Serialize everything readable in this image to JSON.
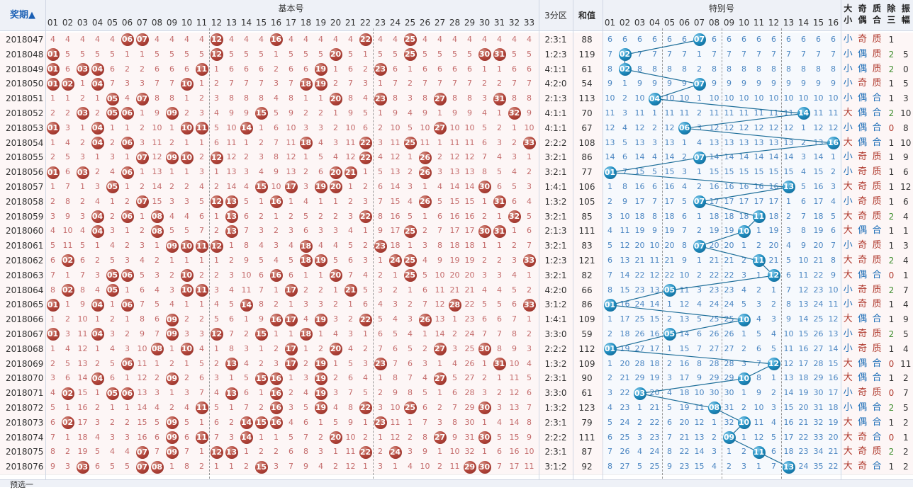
{
  "header": {
    "period_label": "奖期",
    "sort_indicator": "▲",
    "basic_title": "基本号",
    "special_title": "特别号",
    "zone3_label": "3分区",
    "sum_label": "和值",
    "size_label": "大小",
    "parity_label": "奇偶",
    "prime_label": "质合",
    "mod3_label": "除三",
    "amp_label": "振幅"
  },
  "basic_numbers": [
    "01",
    "02",
    "03",
    "04",
    "05",
    "06",
    "07",
    "08",
    "09",
    "10",
    "11",
    "12",
    "13",
    "14",
    "15",
    "16",
    "17",
    "18",
    "19",
    "20",
    "21",
    "22",
    "23",
    "24",
    "25",
    "26",
    "27",
    "28",
    "29",
    "30",
    "31",
    "32",
    "33"
  ],
  "special_numbers": [
    "01",
    "02",
    "03",
    "04",
    "05",
    "06",
    "07",
    "08",
    "09",
    "10",
    "11",
    "12",
    "13",
    "14",
    "15",
    "16"
  ],
  "rows": [
    {
      "period": "2018047",
      "basic": [
        6,
        7,
        12,
        16,
        22,
        25
      ],
      "special": 7,
      "zone": "2:3:1",
      "sum": "88",
      "size": "小",
      "parity": "奇",
      "prime": "质",
      "mod3": "1",
      "amp": ""
    },
    {
      "period": "2018048",
      "basic": [
        1,
        12,
        20,
        25,
        30,
        31
      ],
      "special": 2,
      "zone": "1:2:3",
      "sum": "119",
      "size": "小",
      "parity": "偶",
      "prime": "质",
      "mod3": "2",
      "amp": "5"
    },
    {
      "period": "2018049",
      "basic": [
        1,
        3,
        4,
        11,
        19,
        23
      ],
      "special": 2,
      "zone": "4:1:1",
      "sum": "61",
      "size": "小",
      "parity": "偶",
      "prime": "质",
      "mod3": "2",
      "amp": "0"
    },
    {
      "period": "2018050",
      "basic": [
        1,
        2,
        4,
        10,
        18,
        19
      ],
      "special": 7,
      "zone": "4:2:0",
      "sum": "54",
      "size": "小",
      "parity": "奇",
      "prime": "质",
      "mod3": "1",
      "amp": "5"
    },
    {
      "period": "2018051",
      "basic": [
        5,
        7,
        20,
        23,
        27,
        31
      ],
      "special": 4,
      "zone": "2:1:3",
      "sum": "113",
      "size": "小",
      "parity": "偶",
      "prime": "合",
      "mod3": "1",
      "amp": "3"
    },
    {
      "period": "2018052",
      "basic": [
        3,
        5,
        6,
        9,
        15,
        32
      ],
      "special": 14,
      "zone": "4:1:1",
      "sum": "70",
      "size": "大",
      "parity": "偶",
      "prime": "合",
      "mod3": "2",
      "amp": "10"
    },
    {
      "period": "2018053",
      "basic": [
        1,
        4,
        10,
        11,
        14,
        27
      ],
      "special": 6,
      "zone": "4:1:1",
      "sum": "67",
      "size": "小",
      "parity": "偶",
      "prime": "合",
      "mod3": "0",
      "amp": "8"
    },
    {
      "period": "2018054",
      "basic": [
        4,
        6,
        18,
        22,
        25,
        33
      ],
      "special": 16,
      "zone": "2:2:2",
      "sum": "108",
      "size": "大",
      "parity": "偶",
      "prime": "合",
      "mod3": "1",
      "amp": "10"
    },
    {
      "period": "2018055",
      "basic": [
        7,
        9,
        10,
        12,
        22,
        26
      ],
      "special": 7,
      "zone": "3:2:1",
      "sum": "86",
      "size": "小",
      "parity": "奇",
      "prime": "质",
      "mod3": "1",
      "amp": "9"
    },
    {
      "period": "2018056",
      "basic": [
        1,
        3,
        6,
        20,
        21,
        26
      ],
      "special": 1,
      "zone": "3:2:1",
      "sum": "77",
      "size": "小",
      "parity": "奇",
      "prime": "质",
      "mod3": "1",
      "amp": "6"
    },
    {
      "period": "2018057",
      "basic": [
        5,
        15,
        17,
        19,
        20,
        30
      ],
      "special": 13,
      "zone": "1:4:1",
      "sum": "106",
      "size": "大",
      "parity": "奇",
      "prime": "质",
      "mod3": "1",
      "amp": "12"
    },
    {
      "period": "2018058",
      "basic": [
        7,
        12,
        13,
        16,
        26,
        31
      ],
      "special": 7,
      "zone": "1:3:2",
      "sum": "105",
      "size": "小",
      "parity": "奇",
      "prime": "质",
      "mod3": "1",
      "amp": "6"
    },
    {
      "period": "2018059",
      "basic": [
        4,
        6,
        8,
        13,
        22,
        32
      ],
      "special": 11,
      "zone": "3:2:1",
      "sum": "85",
      "size": "大",
      "parity": "奇",
      "prime": "质",
      "mod3": "2",
      "amp": "4"
    },
    {
      "period": "2018060",
      "basic": [
        4,
        8,
        13,
        25,
        30,
        31
      ],
      "special": 10,
      "zone": "2:1:3",
      "sum": "111",
      "size": "大",
      "parity": "偶",
      "prime": "合",
      "mod3": "1",
      "amp": "1"
    },
    {
      "period": "2018061",
      "basic": [
        9,
        10,
        11,
        12,
        18,
        23
      ],
      "special": 7,
      "zone": "3:2:1",
      "sum": "83",
      "size": "小",
      "parity": "奇",
      "prime": "质",
      "mod3": "1",
      "amp": "3"
    },
    {
      "period": "2018062",
      "basic": [
        2,
        18,
        19,
        24,
        25,
        33
      ],
      "special": 11,
      "zone": "1:2:3",
      "sum": "121",
      "size": "大",
      "parity": "奇",
      "prime": "质",
      "mod3": "2",
      "amp": "4"
    },
    {
      "period": "2018063",
      "basic": [
        5,
        6,
        10,
        16,
        20,
        25
      ],
      "special": 12,
      "zone": "3:2:1",
      "sum": "82",
      "size": "大",
      "parity": "偶",
      "prime": "合",
      "mod3": "0",
      "amp": "1"
    },
    {
      "period": "2018064",
      "basic": [
        2,
        5,
        10,
        11,
        17,
        21
      ],
      "special": 5,
      "zone": "4:2:0",
      "sum": "66",
      "size": "小",
      "parity": "奇",
      "prime": "质",
      "mod3": "2",
      "amp": "7"
    },
    {
      "period": "2018065",
      "basic": [
        1,
        4,
        6,
        14,
        28,
        33
      ],
      "special": 1,
      "zone": "3:1:2",
      "sum": "86",
      "size": "小",
      "parity": "奇",
      "prime": "质",
      "mod3": "1",
      "amp": "4"
    },
    {
      "period": "2018066",
      "basic": [
        9,
        16,
        17,
        19,
        22,
        26
      ],
      "special": 10,
      "zone": "1:4:1",
      "sum": "109",
      "size": "大",
      "parity": "偶",
      "prime": "合",
      "mod3": "1",
      "amp": "9"
    },
    {
      "period": "2018067",
      "basic": [
        1,
        4,
        9,
        12,
        15,
        18
      ],
      "special": 5,
      "zone": "3:3:0",
      "sum": "59",
      "size": "小",
      "parity": "奇",
      "prime": "质",
      "mod3": "2",
      "amp": "5"
    },
    {
      "period": "2018068",
      "basic": [
        8,
        10,
        17,
        20,
        27,
        30
      ],
      "special": 1,
      "zone": "2:2:2",
      "sum": "112",
      "size": "小",
      "parity": "奇",
      "prime": "质",
      "mod3": "1",
      "amp": "4"
    },
    {
      "period": "2018069",
      "basic": [
        6,
        13,
        17,
        19,
        23,
        31
      ],
      "special": 12,
      "zone": "1:3:2",
      "sum": "109",
      "size": "大",
      "parity": "偶",
      "prime": "合",
      "mod3": "0",
      "amp": "11"
    },
    {
      "period": "2018070",
      "basic": [
        4,
        9,
        15,
        16,
        19,
        27
      ],
      "special": 10,
      "zone": "2:3:1",
      "sum": "90",
      "size": "大",
      "parity": "偶",
      "prime": "合",
      "mod3": "1",
      "amp": "2"
    },
    {
      "period": "2018071",
      "basic": [
        2,
        5,
        6,
        13,
        16,
        19
      ],
      "special": 3,
      "zone": "3:3:0",
      "sum": "61",
      "size": "小",
      "parity": "奇",
      "prime": "质",
      "mod3": "0",
      "amp": "7"
    },
    {
      "period": "2018072",
      "basic": [
        11,
        16,
        19,
        22,
        25,
        30
      ],
      "special": 8,
      "zone": "1:3:2",
      "sum": "123",
      "size": "小",
      "parity": "偶",
      "prime": "合",
      "mod3": "2",
      "amp": "5"
    },
    {
      "period": "2018073",
      "basic": [
        2,
        9,
        14,
        15,
        16,
        23
      ],
      "special": 10,
      "zone": "2:3:1",
      "sum": "79",
      "size": "大",
      "parity": "偶",
      "prime": "合",
      "mod3": "1",
      "amp": "2"
    },
    {
      "period": "2018074",
      "basic": [
        9,
        11,
        14,
        20,
        27,
        30
      ],
      "special": 9,
      "zone": "2:2:2",
      "sum": "111",
      "size": "大",
      "parity": "奇",
      "prime": "合",
      "mod3": "0",
      "amp": "1"
    },
    {
      "period": "2018075",
      "basic": [
        7,
        9,
        12,
        13,
        22,
        24
      ],
      "special": 11,
      "zone": "2:3:1",
      "sum": "87",
      "size": "大",
      "parity": "奇",
      "prime": "质",
      "mod3": "2",
      "amp": "2"
    },
    {
      "period": "2018076",
      "basic": [
        3,
        7,
        8,
        15,
        29,
        30
      ],
      "special": 13,
      "zone": "3:1:2",
      "sum": "92",
      "size": "大",
      "parity": "奇",
      "prime": "合",
      "mod3": "1",
      "amp": "2"
    }
  ],
  "footer": {
    "label": "预选一"
  }
}
